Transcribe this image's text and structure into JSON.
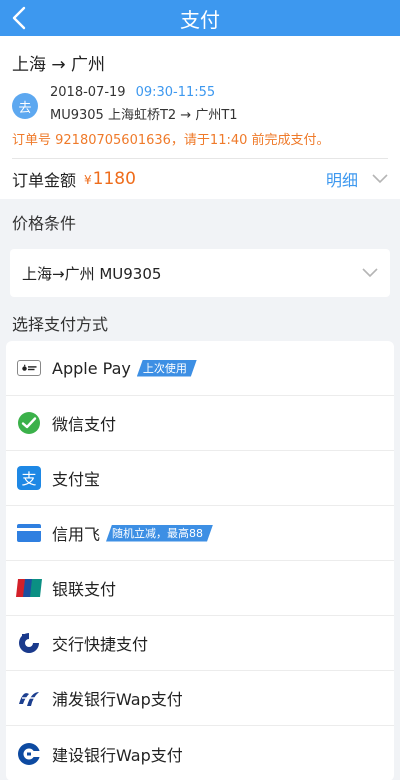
{
  "header": {
    "title": "支付"
  },
  "trip": {
    "route": "上海 → 广州",
    "badge": "去",
    "date": "2018-07-19",
    "time": "09:30-11:55",
    "flight": "MU9305  上海虹桥T2 → 广州T1",
    "notice": "订单号 92180705601636，请于11:40 前完成支付。"
  },
  "amount": {
    "label": "订单金额",
    "currency": "¥",
    "value": "1180",
    "detail_label": "明细"
  },
  "price_condition": {
    "title": "价格条件",
    "value": "上海→广州 MU9305"
  },
  "payment": {
    "title": "选择支付方式",
    "methods": [
      {
        "name": "Apple Pay",
        "icon": "apple-pay-icon",
        "tag": "上次使用"
      },
      {
        "name": "微信支付",
        "icon": "wechat-pay-icon",
        "tag": ""
      },
      {
        "name": "支付宝",
        "icon": "alipay-icon",
        "tag": ""
      },
      {
        "name": "信用飞",
        "icon": "credit-card-icon",
        "tag": "随机立减，最高88"
      },
      {
        "name": "银联支付",
        "icon": "unionpay-icon",
        "tag": ""
      },
      {
        "name": "交行快捷支付",
        "icon": "bocom-icon",
        "tag": ""
      },
      {
        "name": "浦发银行Wap支付",
        "icon": "spdb-icon",
        "tag": ""
      },
      {
        "name": "建设银行Wap支付",
        "icon": "ccb-icon",
        "tag": ""
      }
    ]
  },
  "colors": {
    "primary": "#3d98ef",
    "orange": "#ef6d1c",
    "wechat": "#3bb14a",
    "alipay": "#1e88e5"
  }
}
